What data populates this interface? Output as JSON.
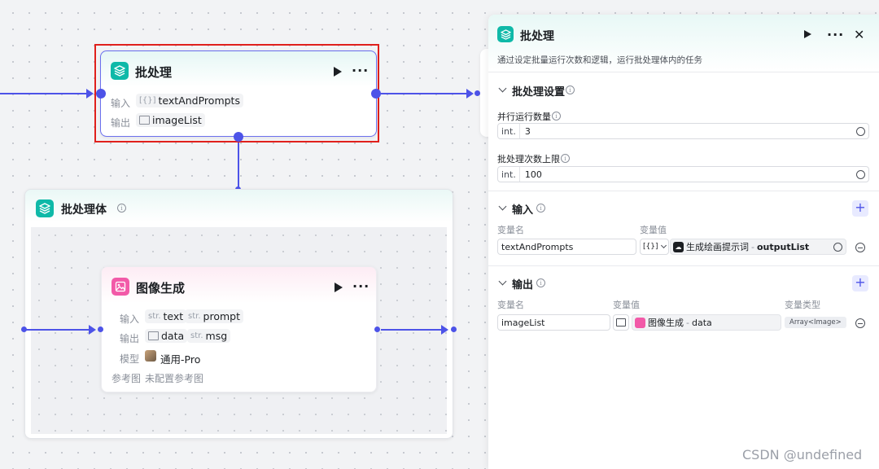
{
  "batch_node": {
    "title": "批处理",
    "input_label": "输入",
    "input_tag_prefix": "[{}]",
    "input_value": "textAndPrompts",
    "output_label": "输出",
    "output_value": "imageList",
    "play_icon": "play-icon",
    "more_icon": "more-icon"
  },
  "batch_body": {
    "title": "批处理体"
  },
  "image_node": {
    "title": "图像生成",
    "input_label": "输入",
    "input_tags": [
      {
        "prefix": "str.",
        "value": "text"
      },
      {
        "prefix": "str.",
        "value": "prompt"
      }
    ],
    "output_label": "输出",
    "output_tags": [
      {
        "prefix": "",
        "value": "data"
      },
      {
        "prefix": "str.",
        "value": "msg"
      }
    ],
    "model_label": "模型",
    "model_value": "通用-Pro",
    "ref_label": "参考图",
    "ref_value": "未配置参考图"
  },
  "panel": {
    "title": "批处理",
    "description": "通过设定批量运行次数和逻辑，运行批处理体内的任务",
    "settings": {
      "title": "批处理设置",
      "parallel_label": "并行运行数量",
      "parallel_prefix": "int.",
      "parallel_value": "3",
      "limit_label": "批处理次数上限",
      "limit_prefix": "int.",
      "limit_value": "100"
    },
    "inputs": {
      "title": "输入",
      "col_name": "变量名",
      "col_value": "变量值",
      "var_name": "textAndPrompts",
      "var_type_prefix": "[{}]",
      "ref_node": "生成绘画提示词",
      "ref_sep": "-",
      "ref_field": "outputList"
    },
    "outputs": {
      "title": "输出",
      "col_name": "变量名",
      "col_value": "变量值",
      "col_type": "变量类型",
      "var_name": "imageList",
      "ref_node": "图像生成",
      "ref_sep": "-",
      "ref_field": "data",
      "type_badge": "Array<Image>"
    }
  },
  "watermark": "CSDN @undefined",
  "colors": {
    "accent": "#4d53e8",
    "teal": "#0fb9a8",
    "pink": "#f25aa8",
    "highlight": "#e0201c"
  }
}
